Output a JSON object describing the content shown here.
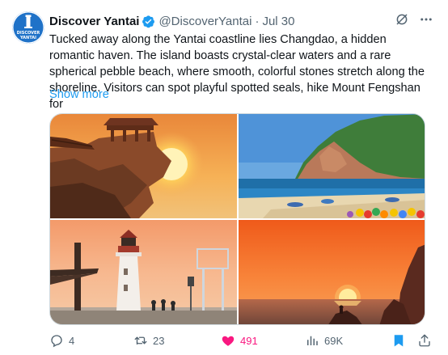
{
  "author": {
    "avatar_text": "DISCOVER\nYANTAI",
    "display_name": "Discover Yantai",
    "handle": "@DiscoverYantai",
    "separator": "·",
    "date": "Jul 30"
  },
  "tweet": {
    "text": "Tucked away along the Yantai coastline lies Changdao, a hidden romantic haven. The island boasts crystal-clear waters and a rare spherical pebble beach, where smooth, colorful stones stretch along the shoreline. Visitors can spot playful spotted seals, hike Mount Fengshan for",
    "show_more": "Show more"
  },
  "media": [
    {
      "icon": "sunset-rock-pavilion-photo"
    },
    {
      "icon": "coastal-beach-cliff-photo"
    },
    {
      "icon": "lighthouse-sunset-photo"
    },
    {
      "icon": "sea-sunset-photo"
    }
  ],
  "engagement": {
    "replies": "4",
    "retweets": "23",
    "likes": "491",
    "views": "69K"
  },
  "colors": {
    "accent": "#1d9bf0",
    "like": "#f91880",
    "muted": "#536471",
    "bookmark": "#1d9bf0"
  }
}
